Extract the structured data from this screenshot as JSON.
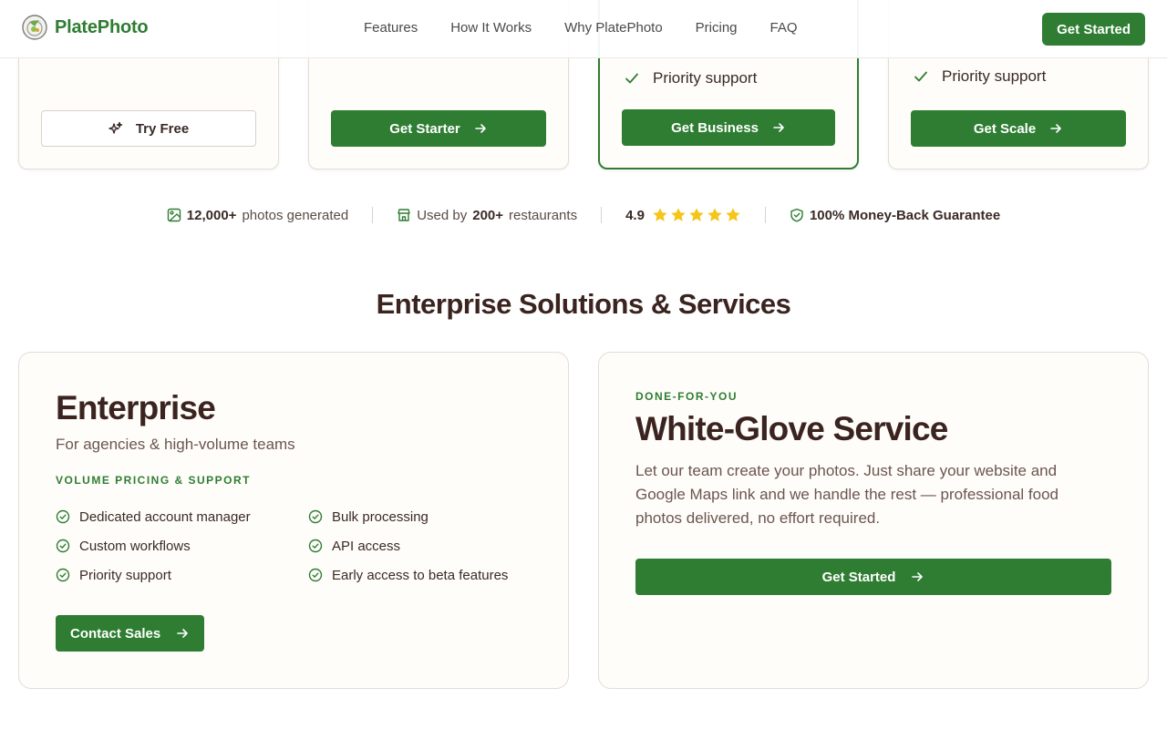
{
  "header": {
    "brand": "PlatePhoto",
    "nav": [
      "Features",
      "How It Works",
      "Why PlatePhoto",
      "Pricing",
      "FAQ"
    ],
    "cta": "Get Started"
  },
  "plans": [
    {
      "features": [],
      "button": "Try Free",
      "button_icon": "sparkle-icon",
      "style": "outline"
    },
    {
      "features": [],
      "button": "Get Starter",
      "button_icon": "arrow-right-icon",
      "style": "primary"
    },
    {
      "features": [
        "Priority support"
      ],
      "button": "Get Business",
      "button_icon": "arrow-right-icon",
      "style": "primary",
      "featured": true
    },
    {
      "features": [
        "Priority support"
      ],
      "button": "Get Scale",
      "button_icon": "arrow-right-icon",
      "style": "primary"
    }
  ],
  "stats": {
    "photos_value": "12,000+",
    "photos_label": "photos generated",
    "used_prefix": "Used by",
    "used_value": "200+",
    "used_label": "restaurants",
    "rating": "4.9",
    "rating_stars": 5,
    "guarantee": "100% Money-Back Guarantee"
  },
  "section": {
    "title": "Enterprise Solutions & Services"
  },
  "enterprise": {
    "title": "Enterprise",
    "subtitle": "For agencies & high-volume teams",
    "eyebrow": "VOLUME PRICING & SUPPORT",
    "features": [
      "Dedicated account manager",
      "Bulk processing",
      "Custom workflows",
      "API access",
      "Priority support",
      "Early access to beta features"
    ],
    "button": "Contact Sales"
  },
  "white_glove": {
    "eyebrow": "DONE-FOR-YOU",
    "title": "White-Glove Service",
    "description": "Let our team create your photos. Just share your website and Google Maps link and we handle the rest — professional food photos delivered, no effort required.",
    "button": "Get Started"
  },
  "colors": {
    "brand_green": "#2e7d32",
    "heading_brown": "#3b2420",
    "star_gold": "#f5c518"
  }
}
